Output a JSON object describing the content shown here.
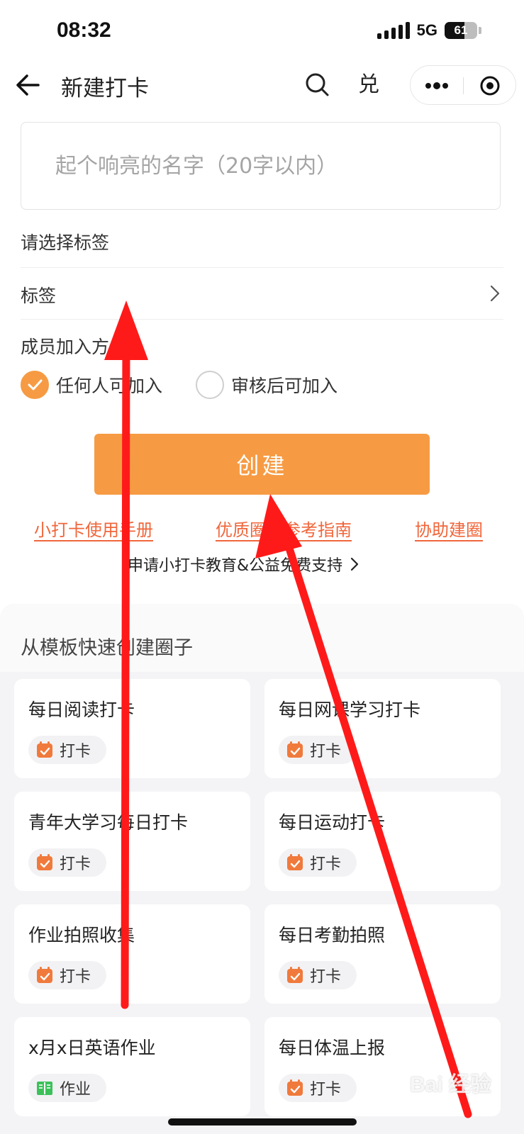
{
  "status_bar": {
    "time": "08:32",
    "network": "5G",
    "battery": "61"
  },
  "nav": {
    "title": "新建打卡",
    "redeem_label": "兑"
  },
  "form": {
    "name_placeholder": "起个响亮的名字（20字以内）",
    "label_section_title": "请选择标签",
    "tag_row_label": "标签",
    "join_section_title": "成员加入方",
    "join_options": [
      {
        "label": "任何人可加入",
        "selected": true
      },
      {
        "label": "审核后可加入",
        "selected": false
      }
    ],
    "create_label": "创建"
  },
  "links": {
    "manual": "小打卡使用手册",
    "guide": "优质圈子参考指南",
    "assist": "协助建圈",
    "support": "申请小打卡教育&公益免费支持"
  },
  "templates": {
    "heading": "从模板快速创建圈子",
    "items": [
      {
        "name": "每日阅读打卡",
        "type": "打卡",
        "icon": "calendar-check-icon"
      },
      {
        "name": "每日网课学习打卡",
        "type": "打卡",
        "icon": "calendar-check-icon"
      },
      {
        "name": "青年大学习每日打卡",
        "type": "打卡",
        "icon": "calendar-check-icon"
      },
      {
        "name": "每日运动打卡",
        "type": "打卡",
        "icon": "calendar-check-icon"
      },
      {
        "name": "作业拍照收集",
        "type": "打卡",
        "icon": "calendar-check-icon"
      },
      {
        "name": "每日考勤拍照",
        "type": "打卡",
        "icon": "calendar-check-icon"
      },
      {
        "name": "x月x日英语作业",
        "type": "作业",
        "icon": "book-icon"
      },
      {
        "name": "每日体温上报",
        "type": "打卡",
        "icon": "calendar-check-icon"
      }
    ]
  },
  "colors": {
    "accent": "#f69b43",
    "link": "#f0663b",
    "annotation": "#ff1a1a",
    "chip_calendar": "#f07a3c",
    "chip_book": "#3cc15a"
  },
  "watermark": "Bai 经验"
}
